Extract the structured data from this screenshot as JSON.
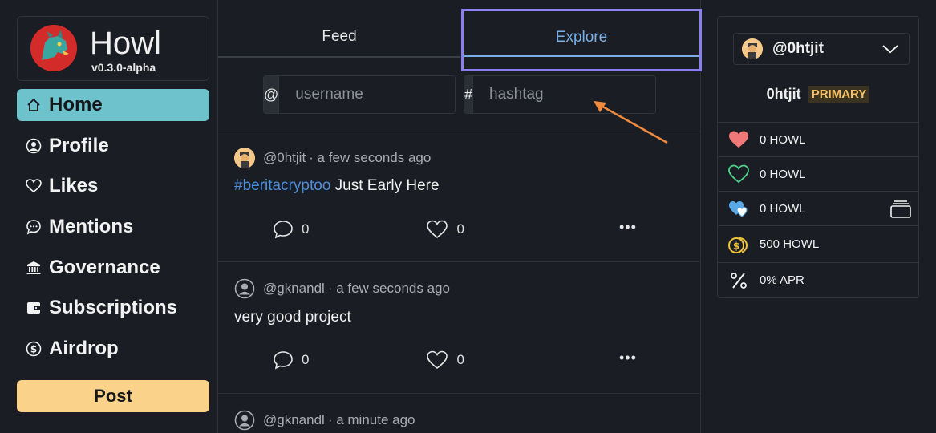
{
  "app": {
    "title": "Howl",
    "version": "v0.3.0-alpha"
  },
  "sidebar": {
    "items": [
      {
        "label": "Home",
        "icon": "home-icon"
      },
      {
        "label": "Profile",
        "icon": "user-icon"
      },
      {
        "label": "Likes",
        "icon": "heart-icon"
      },
      {
        "label": "Mentions",
        "icon": "chat-icon"
      },
      {
        "label": "Governance",
        "icon": "bank-icon"
      },
      {
        "label": "Subscriptions",
        "icon": "wallet-icon"
      },
      {
        "label": "Airdrop",
        "icon": "coin-icon"
      }
    ],
    "post_label": "Post"
  },
  "tabs": [
    {
      "label": "Feed"
    },
    {
      "label": "Explore"
    }
  ],
  "search": {
    "username_prefix": "@",
    "username_placeholder": "username",
    "hashtag_prefix": "#",
    "hashtag_placeholder": "hashtag"
  },
  "posts": [
    {
      "author": "@0htjit",
      "time": "· a few seconds ago",
      "hashtag": "#beritacryptoo",
      "text": " Just Early Here",
      "comments": "0",
      "likes": "0"
    },
    {
      "author": "@gknandl",
      "time": "· a few seconds ago",
      "hashtag": "",
      "text": "very good project",
      "comments": "0",
      "likes": "0"
    },
    {
      "author": "@gknandl",
      "time": "· a minute ago",
      "hashtag": "",
      "text": "",
      "comments": "",
      "likes": ""
    }
  ],
  "account": {
    "handle": "@0htjit",
    "name": "0htjit",
    "badge": "PRIMARY"
  },
  "balances": [
    {
      "label": "0 HOWL",
      "icon": "heart-filled-icon",
      "color": "#f07878"
    },
    {
      "label": "0 HOWL",
      "icon": "heart-outline-icon",
      "color": "#4fd08a"
    },
    {
      "label": "0 HOWL",
      "icon": "hearts-icon",
      "color": "#5aa8e8"
    },
    {
      "label": "500 HOWL",
      "icon": "coins-icon",
      "color": "#f0c23a"
    },
    {
      "label": "0% APR",
      "icon": "percent-icon",
      "color": "#f0f0f0"
    }
  ],
  "colors": {
    "background": "#1a1d23",
    "home_active": "#6ec2cc",
    "post_button": "#fbd28a",
    "explore_tab": "#7aaee6",
    "highlight_border": "#8a7ef0",
    "annotation_arrow": "#f08a3e",
    "hashtag_link": "#4b8fdc"
  }
}
